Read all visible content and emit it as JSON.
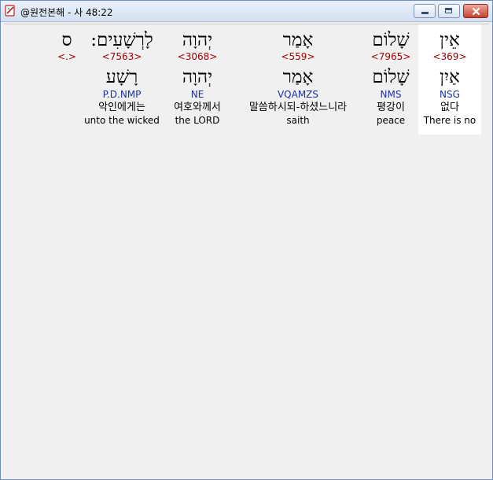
{
  "window": {
    "title": "@원전본해 - 사 48:22"
  },
  "words": [
    {
      "hebrew": "אֵין",
      "strong": "<369>",
      "lemma": "אַיִן",
      "parse": "NSG",
      "korean": "없다",
      "english": "There is no"
    },
    {
      "hebrew": "שָׁלוֹם",
      "strong": "<7965>",
      "lemma": "שָׁלוֹם",
      "parse": "NMS",
      "korean": "평강이",
      "english": "peace"
    },
    {
      "hebrew": "אָמַר",
      "strong": "<559>",
      "lemma": "אָמַר",
      "parse": "VQAMZS",
      "korean": "말씀하시되-하셨느니라",
      "english": "saith"
    },
    {
      "hebrew": "יְהוָה",
      "strong": "<3068>",
      "lemma": "יְהוָה",
      "parse": "NE",
      "korean": "여호와께서",
      "english": "the LORD"
    },
    {
      "hebrew": "לָרְשָׁעִים:",
      "strong": "<7563>",
      "lemma": "רָשָׁע",
      "parse": "P.D.NMP",
      "korean": "악인에게는",
      "english": "unto the wicked"
    },
    {
      "hebrew": "ס",
      "strong": "<.>"
    }
  ],
  "icons": {
    "app": "bible-book-icon",
    "minimize": "minimize-icon",
    "maximize": "maximize-icon",
    "close": "close-icon"
  }
}
